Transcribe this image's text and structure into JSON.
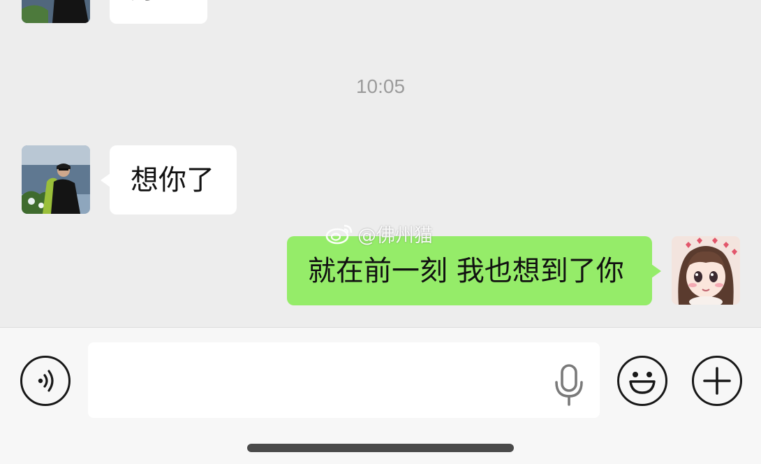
{
  "chat": {
    "messages": [
      {
        "sender": "contact",
        "text": "好的"
      },
      {
        "sender": "contact",
        "text": "想你了"
      },
      {
        "sender": "me",
        "text": "就在前一刻 我也想到了你"
      }
    ],
    "timestamp": "10:05",
    "watermark": "@佛州猫"
  },
  "input_bar": {
    "placeholder": "",
    "value": ""
  },
  "icons": {
    "voice": "voice-mode-icon",
    "mic": "microphone-icon",
    "emoji": "emoji-icon",
    "plus": "plus-icon",
    "watermark_logo": "weibo-logo-icon"
  },
  "colors": {
    "background": "#ededed",
    "incoming_bubble": "#ffffff",
    "outgoing_bubble": "#95ec69",
    "timestamp": "#9b9b9b",
    "input_bar": "#f7f7f7"
  }
}
